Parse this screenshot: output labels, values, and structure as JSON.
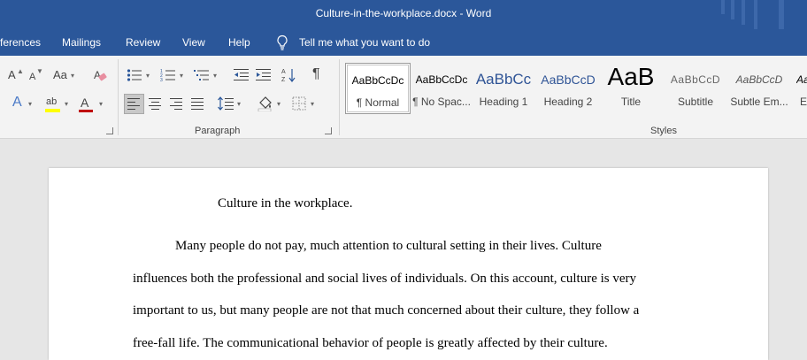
{
  "window": {
    "title": "Culture-in-the-workplace.docx  -  Word"
  },
  "tabs": {
    "references": "ferences",
    "mailings": "Mailings",
    "review": "Review",
    "view": "View",
    "help": "Help",
    "tell_me": "Tell me what you want to do"
  },
  "ribbon": {
    "font": {
      "grow": "A",
      "shrink": "A",
      "change_case": "Aa",
      "text_effects": "A",
      "highlight": "ab",
      "font_color": "A",
      "highlight_color": "#ffff00",
      "font_color_bar": "#c00000"
    },
    "paragraph": {
      "label": "Paragraph",
      "pilcrow": "¶"
    },
    "styles": {
      "label": "Styles",
      "items": [
        {
          "preview": "AaBbCcDc",
          "name": "¶ Normal"
        },
        {
          "preview": "AaBbCcDc",
          "name": "¶ No Spac..."
        },
        {
          "preview": "AaBbCc",
          "name": "Heading 1"
        },
        {
          "preview": "AaBbCcD",
          "name": "Heading 2"
        },
        {
          "preview": "AaB",
          "name": "Title"
        },
        {
          "preview": "AaBbCcD",
          "name": "Subtitle"
        },
        {
          "preview": "AaBbCcD",
          "name": "Subtle Em..."
        },
        {
          "preview": "Aa",
          "name": "E"
        }
      ]
    }
  },
  "document": {
    "title": "Culture in the workplace.",
    "lines": [
      "Many people do not pay, much attention to cultural setting in their lives. Culture",
      "influences both the professional and social lives of individuals. On this account, culture is very",
      "important to us, but many people are not that much concerned about their culture, they follow a",
      "free-fall life. The communicational behavior of people is greatly affected by their culture."
    ]
  },
  "colors": {
    "titlebar": "#2b579a",
    "heading_blue": "#2f5496"
  }
}
